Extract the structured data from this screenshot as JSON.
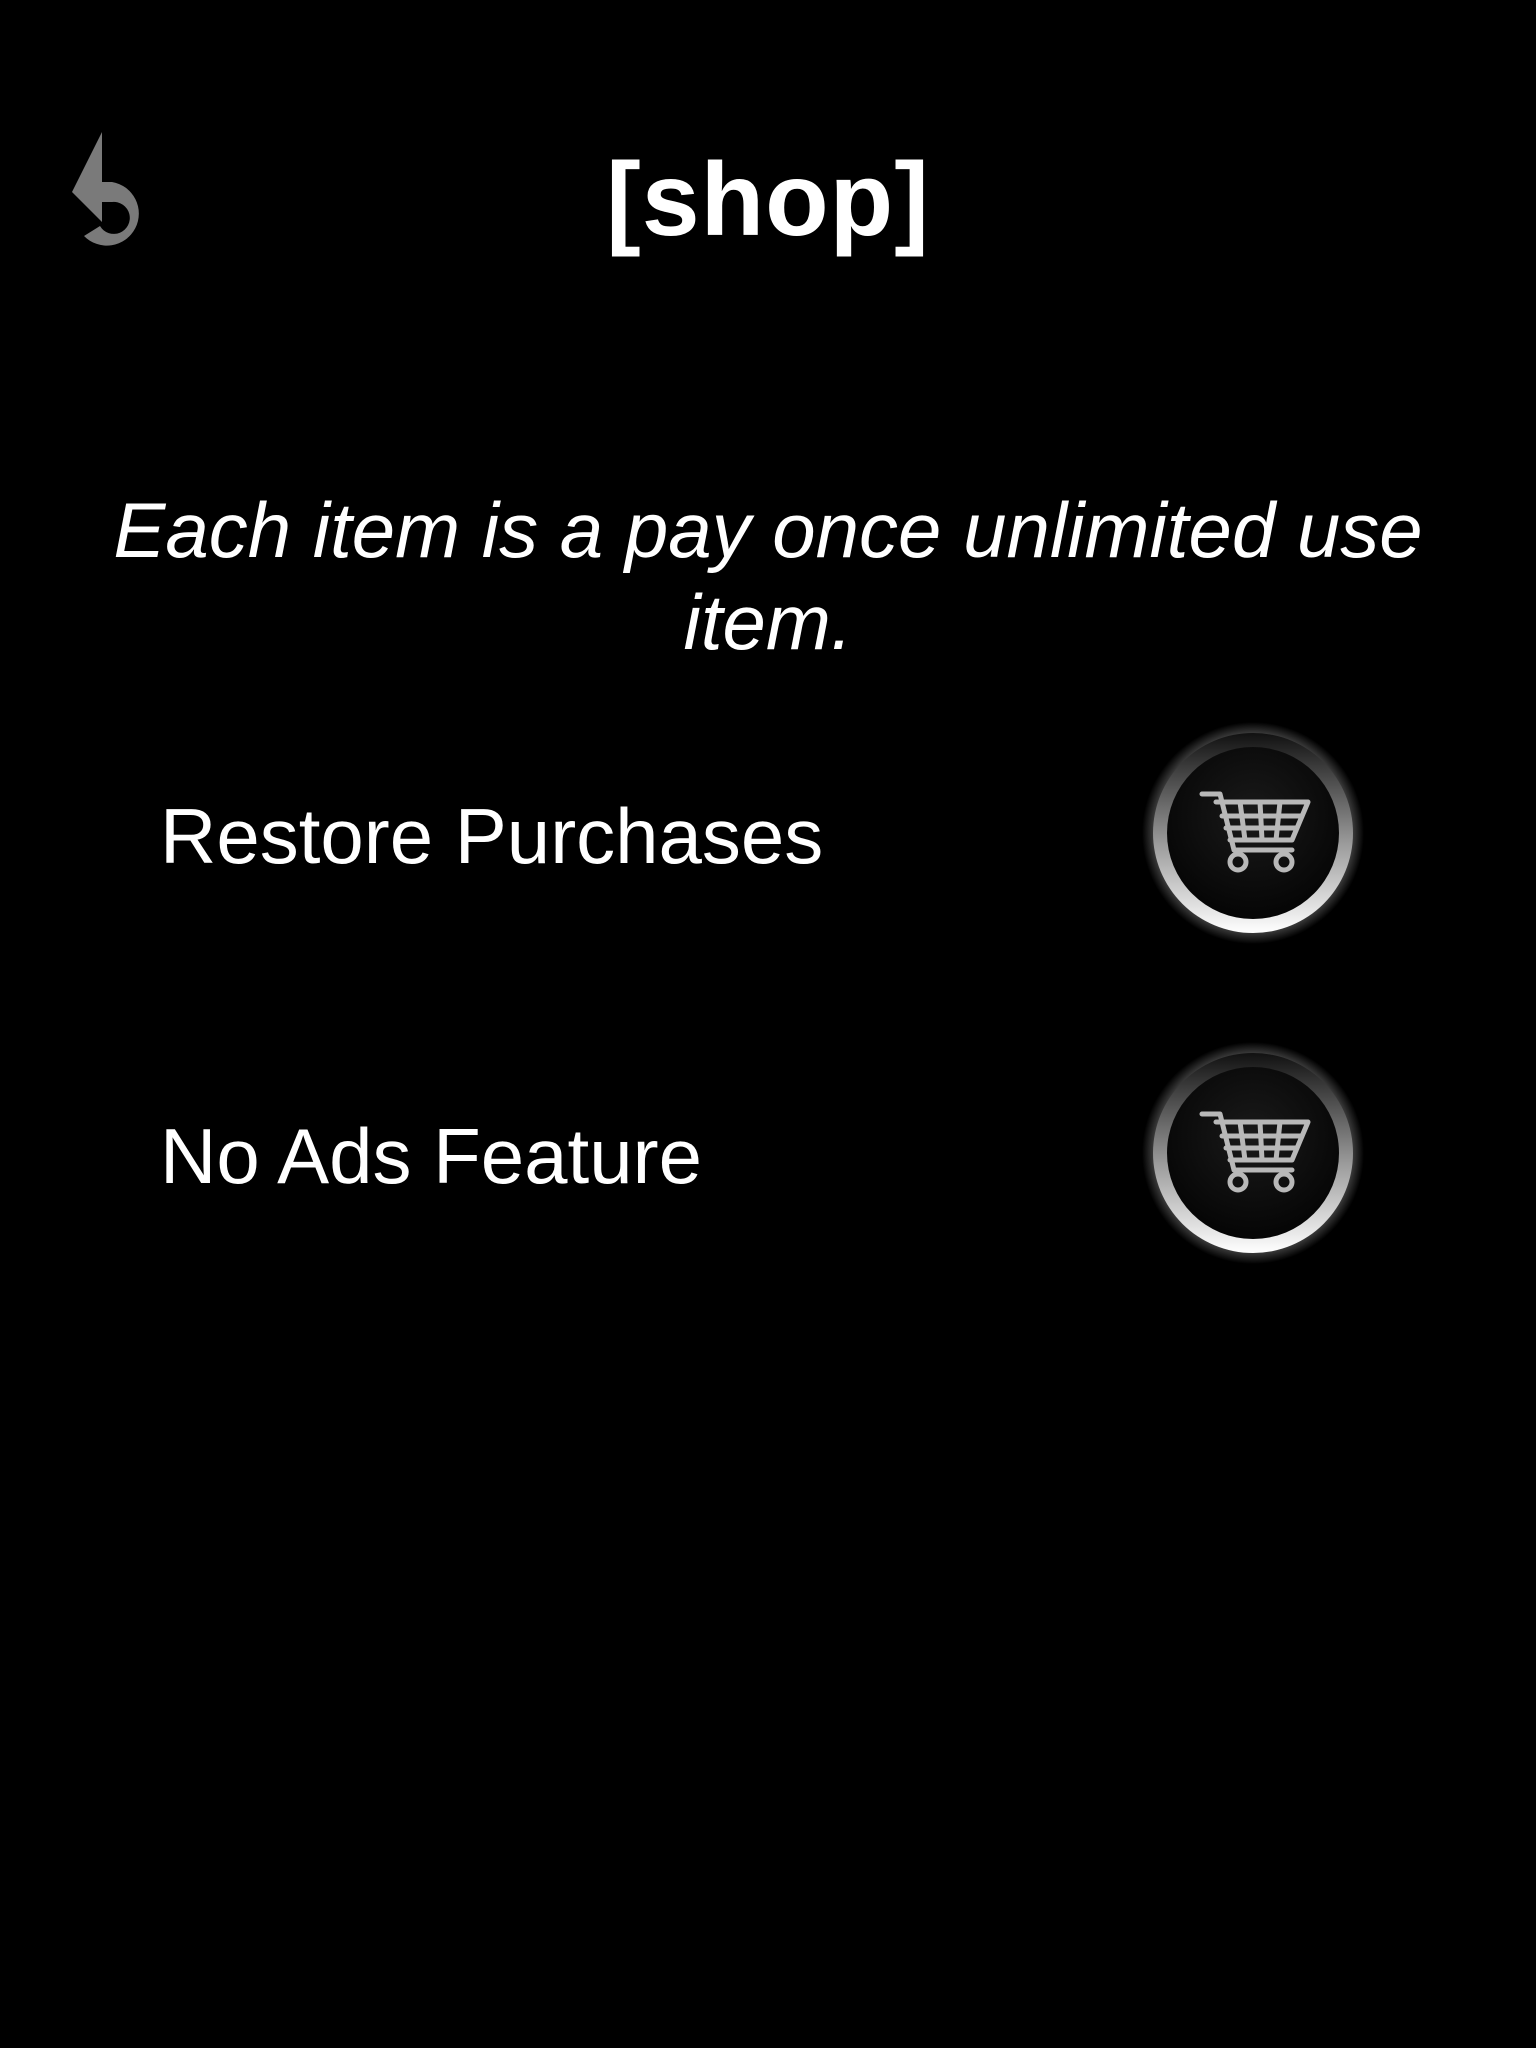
{
  "header": {
    "title": "[shop]",
    "back_icon": "undo-arrow-icon"
  },
  "intro": {
    "text": "Each item is a pay once unlimited use item."
  },
  "items": [
    {
      "label": "Restore Purchases",
      "button_icon": "shopping-cart-icon"
    },
    {
      "label": "No Ads Feature",
      "button_icon": "shopping-cart-icon"
    }
  ],
  "colors": {
    "background": "#000000",
    "text": "#ffffff",
    "back_icon": "#7a7a7a"
  }
}
